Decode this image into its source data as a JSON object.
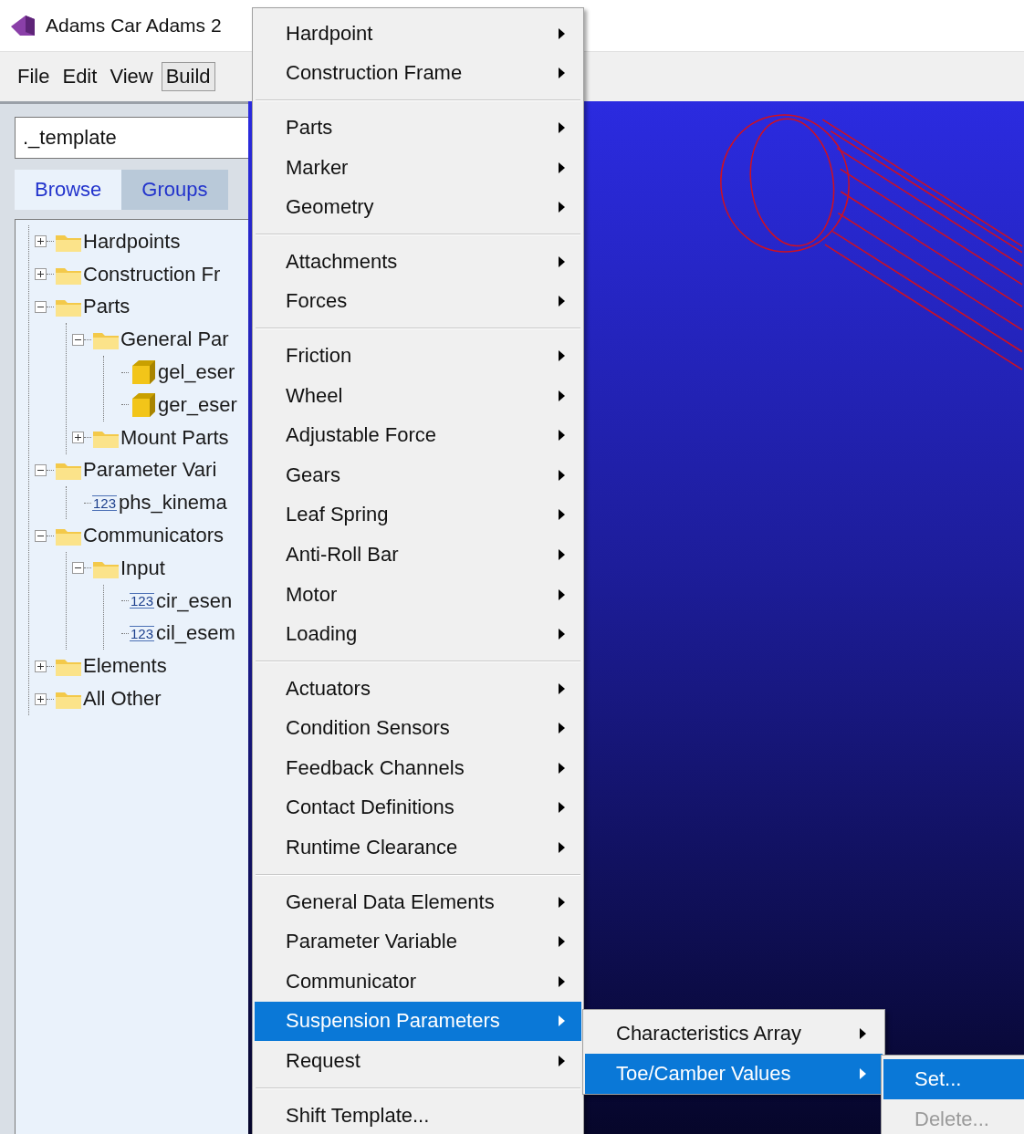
{
  "window": {
    "title": "Adams Car Adams 2"
  },
  "menubar": [
    {
      "label": "File",
      "selected": false
    },
    {
      "label": "Edit",
      "selected": false
    },
    {
      "label": "View",
      "selected": false
    },
    {
      "label": "Build",
      "selected": true
    }
  ],
  "model_field": {
    "value": "._template"
  },
  "tabs": [
    {
      "label": "Browse",
      "selected": true
    },
    {
      "label": "Groups",
      "selected": false
    }
  ],
  "tree": [
    {
      "label": "Hardpoints",
      "kind": "folder",
      "expanded": false
    },
    {
      "label": "Construction Fr",
      "kind": "folder",
      "expanded": false
    },
    {
      "label": "Parts",
      "kind": "folder",
      "expanded": true,
      "children": [
        {
          "label": "General Par",
          "kind": "folder",
          "expanded": true,
          "children": [
            {
              "label": "gel_eser",
              "kind": "part"
            },
            {
              "label": "ger_eser",
              "kind": "part"
            }
          ]
        },
        {
          "label": "Mount Parts",
          "kind": "folder",
          "expanded": false
        }
      ]
    },
    {
      "label": "Parameter Vari",
      "kind": "folder",
      "expanded": true,
      "children": [
        {
          "label": "phs_kinema",
          "kind": "variable",
          "badge": "123"
        }
      ]
    },
    {
      "label": "Communicators",
      "kind": "folder",
      "expanded": true,
      "children": [
        {
          "label": "Input",
          "kind": "folder",
          "expanded": true,
          "children": [
            {
              "label": "cir_esen",
              "kind": "variable",
              "badge": "123"
            },
            {
              "label": "cil_esem",
              "kind": "variable",
              "badge": "123"
            }
          ]
        }
      ]
    },
    {
      "label": "Elements",
      "kind": "folder",
      "expanded": false
    },
    {
      "label": "All Other",
      "kind": "folder",
      "expanded": false
    }
  ],
  "build_menu": {
    "groups": [
      {
        "items": [
          {
            "label": "Hardpoint",
            "submenu": true,
            "selected": false
          },
          {
            "label": "Construction Frame",
            "submenu": true,
            "selected": false
          }
        ]
      },
      {
        "items": [
          {
            "label": "Parts",
            "submenu": true,
            "selected": false
          },
          {
            "label": "Marker",
            "submenu": true,
            "selected": false
          },
          {
            "label": "Geometry",
            "submenu": true,
            "selected": false
          }
        ]
      },
      {
        "items": [
          {
            "label": "Attachments",
            "submenu": true,
            "selected": false
          },
          {
            "label": "Forces",
            "submenu": true,
            "selected": false
          }
        ]
      },
      {
        "items": [
          {
            "label": "Friction",
            "submenu": true,
            "selected": false
          },
          {
            "label": "Wheel",
            "submenu": true,
            "selected": false
          },
          {
            "label": "Adjustable Force",
            "submenu": true,
            "selected": false
          },
          {
            "label": "Gears",
            "submenu": true,
            "selected": false
          },
          {
            "label": "Leaf Spring",
            "submenu": true,
            "selected": false
          },
          {
            "label": "Anti-Roll Bar",
            "submenu": true,
            "selected": false
          },
          {
            "label": "Motor",
            "submenu": true,
            "selected": false
          },
          {
            "label": "Loading",
            "submenu": true,
            "selected": false
          }
        ]
      },
      {
        "items": [
          {
            "label": "Actuators",
            "submenu": true,
            "selected": false
          },
          {
            "label": "Condition Sensors",
            "submenu": true,
            "selected": false
          },
          {
            "label": "Feedback Channels",
            "submenu": true,
            "selected": false
          },
          {
            "label": "Contact Definitions",
            "submenu": true,
            "selected": false
          },
          {
            "label": "Runtime Clearance",
            "submenu": true,
            "selected": false
          }
        ]
      },
      {
        "items": [
          {
            "label": "General Data Elements",
            "submenu": true,
            "selected": false
          },
          {
            "label": "Parameter Variable",
            "submenu": true,
            "selected": false
          },
          {
            "label": "Communicator",
            "submenu": true,
            "selected": false
          },
          {
            "label": "Suspension Parameters",
            "submenu": true,
            "selected": true
          },
          {
            "label": "Request",
            "submenu": true,
            "selected": false
          }
        ]
      },
      {
        "items": [
          {
            "label": "Shift Template...",
            "submenu": false,
            "selected": false
          }
        ]
      }
    ]
  },
  "suspension_submenu": {
    "items": [
      {
        "label": "Characteristics Array",
        "submenu": true,
        "selected": false
      },
      {
        "label": "Toe/Camber Values",
        "submenu": true,
        "selected": true
      }
    ]
  },
  "toe_camber_submenu": {
    "items": [
      {
        "label": "Set...",
        "selected": true,
        "disabled": false
      },
      {
        "label": "Delete...",
        "selected": false,
        "disabled": true
      }
    ]
  }
}
